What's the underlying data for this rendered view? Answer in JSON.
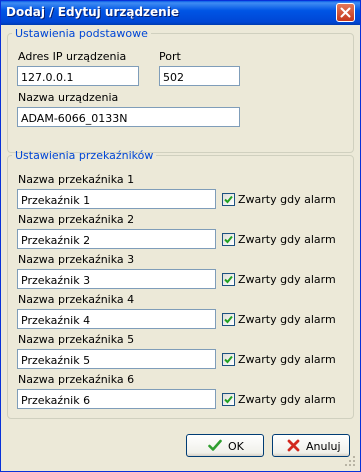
{
  "window": {
    "title": "Dodaj / Edytuj urządzenie"
  },
  "basic_settings": {
    "legend": "Ustawienia podstawowe",
    "ip_label": "Adres IP urządzenia",
    "ip_value": "127.0.0.1",
    "port_label": "Port",
    "port_value": "502",
    "name_label": "Nazwa urządzenia",
    "name_value": "ADAM-6066_0133N"
  },
  "relay_settings": {
    "legend": "Ustawienia przekaźników",
    "relays": [
      {
        "label": "Nazwa przekaźnika 1",
        "value": "Przekaźnik 1",
        "checkbox_label": "Zwarty gdy alarm",
        "checked": true
      },
      {
        "label": "Nazwa przekaźnika 2",
        "value": "Przekaźnik 2",
        "checkbox_label": "Zwarty gdy alarm",
        "checked": true
      },
      {
        "label": "Nazwa przekaźnika 3",
        "value": "Przekaźnik 3",
        "checkbox_label": "Zwarty gdy alarm",
        "checked": true
      },
      {
        "label": "Nazwa przekaźnika 4",
        "value": "Przekaźnik 4",
        "checkbox_label": "Zwarty gdy alarm",
        "checked": true
      },
      {
        "label": "Nazwa przekaźnika 5",
        "value": "Przekaźnik 5",
        "checkbox_label": "Zwarty gdy alarm",
        "checked": true
      },
      {
        "label": "Nazwa przekaźnika 6",
        "value": "Przekaźnik 6",
        "checkbox_label": "Zwarty gdy alarm",
        "checked": true
      }
    ]
  },
  "buttons": {
    "ok_label": "OK",
    "cancel_label": "Anuluj"
  },
  "icons": {
    "ok": "checkmark-icon",
    "cancel": "x-mark-icon",
    "close": "close-icon",
    "checkbox": "checkmark-icon"
  },
  "colors": {
    "titlebar": "#0055e5",
    "legend_text": "#0046d5",
    "ok_icon": "#2f9e2f",
    "cancel_icon": "#d2281e"
  }
}
